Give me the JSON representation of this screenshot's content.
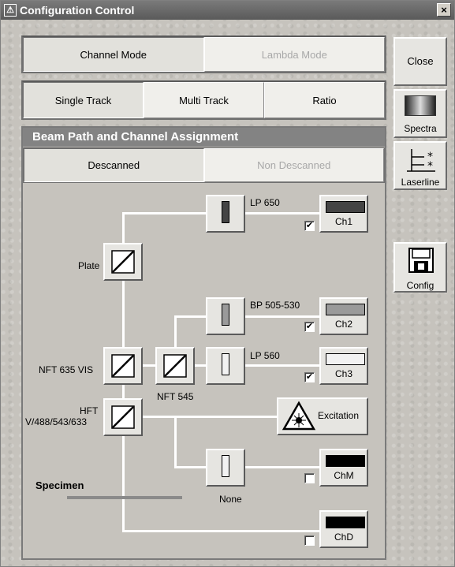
{
  "window": {
    "title": "Configuration Control",
    "close_glyph": "×"
  },
  "mode_tabs": [
    {
      "label": "Channel Mode",
      "state": "active"
    },
    {
      "label": "Lambda Mode",
      "state": "disabled"
    }
  ],
  "track_tabs": [
    {
      "label": "Single Track",
      "state": "active"
    },
    {
      "label": "Multi Track",
      "state": "normal"
    },
    {
      "label": "Ratio",
      "state": "normal"
    }
  ],
  "side_buttons": {
    "close": "Close",
    "spectra": "Spectra",
    "laserline": "Laserline",
    "config": "Config"
  },
  "beam_path": {
    "title": "Beam Path and Channel Assignment",
    "tabs": [
      {
        "label": "Descanned",
        "state": "active"
      },
      {
        "label": "Non Descanned",
        "state": "disabled"
      }
    ],
    "mirrors": {
      "plate": "Plate",
      "nft635": "NFT 635 VIS",
      "nft545": "NFT 545",
      "hft_line1": "HFT",
      "hft_line2": "V/488/543/633"
    },
    "filters": {
      "lp650": "LP 650",
      "bp505": "BP 505-530",
      "lp560": "LP 560",
      "none": "None"
    },
    "channels": [
      {
        "label": "Ch1",
        "checked": true,
        "color": "#444444"
      },
      {
        "label": "Ch2",
        "checked": true,
        "color": "#9a9a9a"
      },
      {
        "label": "Ch3",
        "checked": true,
        "color": "#f2f2f2"
      },
      {
        "label": "ChM",
        "checked": false,
        "color": "#000000"
      },
      {
        "label": "ChD",
        "checked": false,
        "color": "#000000"
      }
    ],
    "excitation": "Excitation",
    "specimen": "Specimen"
  },
  "colors": {
    "titlebar": "#6a6a6a",
    "panel_header": "#838383",
    "beam_line": "#ffffff"
  },
  "icons": {
    "window": "app-icon",
    "spectra": "spectra-gradient-icon",
    "laserline": "laserline-icon",
    "config": "floppy-disk-icon",
    "excitation": "laser-warning-icon"
  }
}
